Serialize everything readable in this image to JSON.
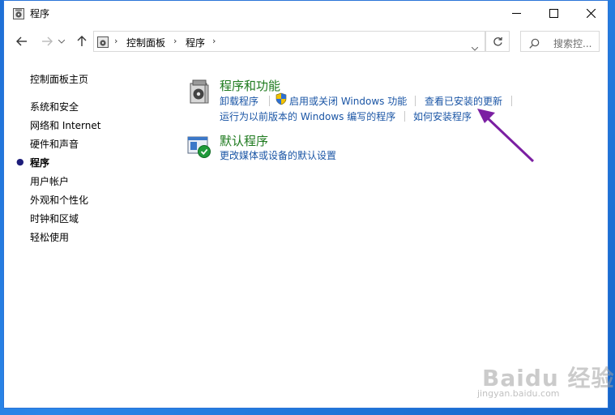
{
  "window": {
    "title": "程序"
  },
  "address_bar": {
    "crumbs": [
      "控制面板",
      "程序"
    ],
    "search_placeholder": "搜索控..."
  },
  "sidebar": {
    "home": "控制面板主页",
    "items": [
      {
        "label": "系统和安全"
      },
      {
        "label": "网络和 Internet"
      },
      {
        "label": "硬件和声音"
      },
      {
        "label": "程序",
        "current": true
      },
      {
        "label": "用户帐户"
      },
      {
        "label": "外观和个性化"
      },
      {
        "label": "时钟和区域"
      },
      {
        "label": "轻松使用"
      }
    ]
  },
  "sections": [
    {
      "title": "程序和功能",
      "links": [
        "卸载程序",
        "启用或关闭 Windows 功能",
        "查看已安装的更新",
        "运行为以前版本的 Windows 编写的程序",
        "如何安装程序"
      ]
    },
    {
      "title": "默认程序",
      "links": [
        "更改媒体或设备的默认设置"
      ]
    }
  ],
  "colors": {
    "desktop": "#1e6fd6",
    "link": "#1a55a5",
    "section_title": "#1e7a1e",
    "annotation_arrow": "#7b1fa2"
  },
  "watermark": {
    "brand": "Baidu 经验",
    "url": "jingyan.baidu.com"
  }
}
